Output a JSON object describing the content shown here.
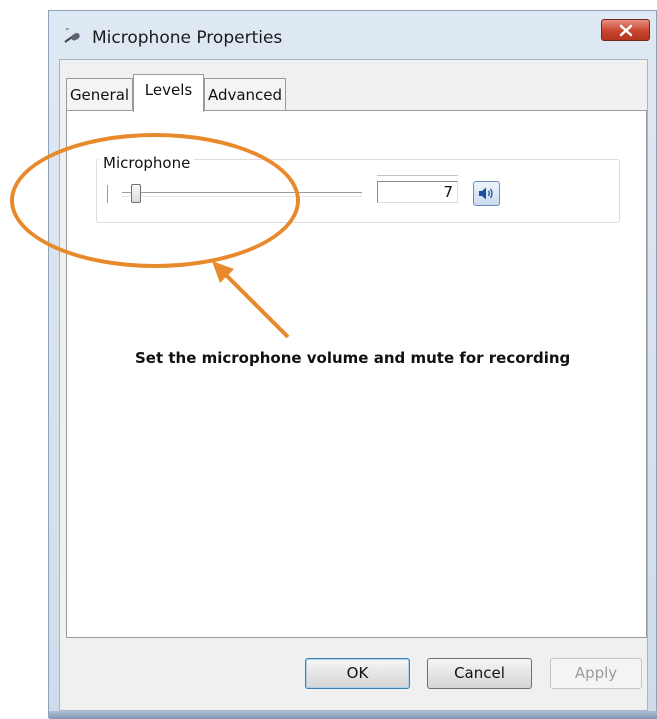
{
  "window": {
    "title": "Microphone Properties"
  },
  "tabs": [
    {
      "label": "General",
      "active": false
    },
    {
      "label": "Levels",
      "active": true
    },
    {
      "label": "Advanced",
      "active": false
    }
  ],
  "levels": {
    "group_label": "Microphone",
    "value": "7",
    "slider_level_percent": 7,
    "mute_icon": "speaker-icon"
  },
  "buttons": {
    "ok": "OK",
    "cancel": "Cancel",
    "apply": "Apply"
  },
  "annotation": {
    "text": "Set the microphone volume and mute for recording",
    "color": "#e88a2c"
  }
}
